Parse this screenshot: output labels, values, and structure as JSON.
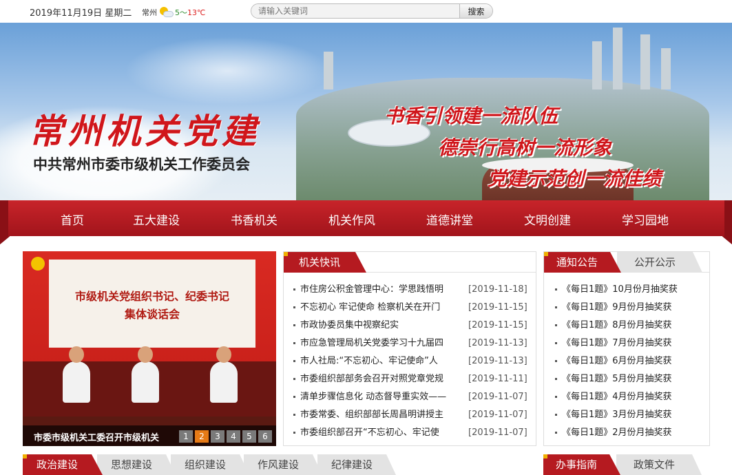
{
  "topbar": {
    "date": "2019年11月19日",
    "weekday": "星期二",
    "city": "常州",
    "temp_low": "5",
    "temp_sep": "～",
    "temp_high": "13℃",
    "weather_icon": "partly-cloudy-icon",
    "search_placeholder": "请输入关键词",
    "search_button": "搜索"
  },
  "banner": {
    "title": "常州机关党建",
    "subtitle": "中共常州市委市级机关工作委员会",
    "slogans": [
      "书香引领建一流队伍",
      "德崇行高树一流形象",
      "党建示范创一流佳绩"
    ]
  },
  "nav": {
    "items": [
      "首页",
      "五大建设",
      "书香机关",
      "机关作风",
      "道德讲堂",
      "文明创建",
      "学习园地"
    ]
  },
  "slideshow": {
    "board_line1": "市级机关党组织书记、纪委书记",
    "board_line2": "集体谈话会",
    "caption": "市委市级机关工委召开市级机关",
    "pages": [
      "1",
      "2",
      "3",
      "4",
      "5",
      "6"
    ],
    "active_page": 2
  },
  "news": {
    "tab": "机关快讯",
    "items": [
      {
        "title": "市住房公积金管理中心：学思践悟明",
        "date": "[2019-11-18]"
      },
      {
        "title": "不忘初心 牢记使命 检察机关在开门",
        "date": "[2019-11-15]"
      },
      {
        "title": "市政协委员集中视察纪实",
        "date": "[2019-11-15]"
      },
      {
        "title": "市应急管理局机关党委学习十九届四",
        "date": "[2019-11-13]"
      },
      {
        "title": "市人社局:“不忘初心、牢记使命”人",
        "date": "[2019-11-13]"
      },
      {
        "title": "市委组织部部务会召开对照党章党规",
        "date": "[2019-11-11]"
      },
      {
        "title": "清单步骤信息化 动态督导重实效——",
        "date": "[2019-11-07]"
      },
      {
        "title": "市委常委、组织部部长周昌明讲授主",
        "date": "[2019-11-07]"
      },
      {
        "title": "市委组织部召开“不忘初心、牢记使",
        "date": "[2019-11-07]"
      }
    ]
  },
  "notice": {
    "tab_active": "通知公告",
    "tab_other": "公开公示",
    "items": [
      "《每日1题》10月份月抽奖获",
      "《每日1题》9月份月抽奖获",
      "《每日1题》8月份月抽奖获",
      "《每日1题》7月份月抽奖获",
      "《每日1题》6月份月抽奖获",
      "《每日1题》5月份月抽奖获",
      "《每日1题》4月份月抽奖获",
      "《每日1题》3月份月抽奖获",
      "《每日1题》2月份月抽奖获"
    ]
  },
  "bottom_tabs": {
    "left": [
      "政治建设",
      "思想建设",
      "组织建设",
      "作风建设",
      "纪律建设"
    ],
    "right": [
      "办事指南",
      "政策文件"
    ]
  },
  "colors": {
    "brand_red": "#b51a20",
    "accent_orange": "#e67a16",
    "corner_gold": "#f0b000"
  }
}
